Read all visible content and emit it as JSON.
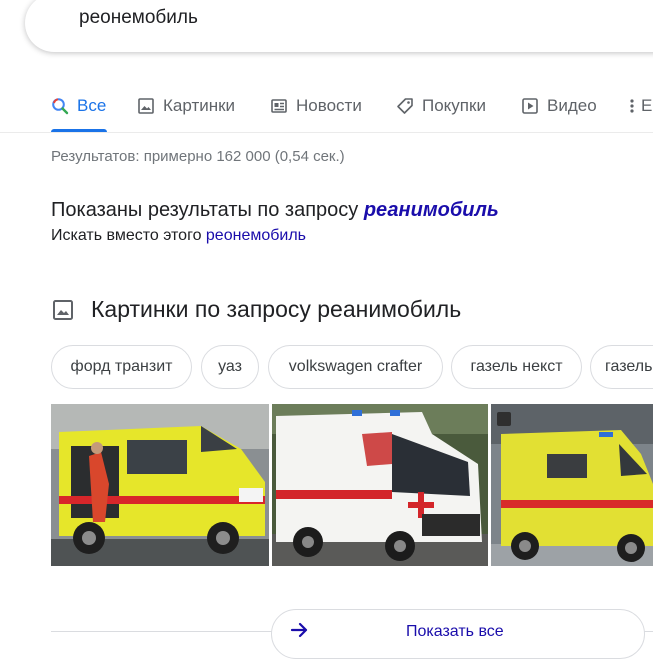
{
  "search": {
    "query": "реонемобиль"
  },
  "tabs": [
    {
      "label": "Все",
      "icon": "search-icon",
      "active": true
    },
    {
      "label": "Картинки",
      "icon": "image-icon"
    },
    {
      "label": "Новости",
      "icon": "news-icon"
    },
    {
      "label": "Покупки",
      "icon": "tag-icon"
    },
    {
      "label": "Видео",
      "icon": "play-icon"
    },
    {
      "label": "Е",
      "icon": "more-vert-icon"
    }
  ],
  "results": {
    "stats": "Результатов: примерно 162 000 (0,54 сек.)",
    "showing_prefix": "Показаны результаты по запросу ",
    "corrected_query": "реанимобиль",
    "instead_prefix": "Искать вместо этого ",
    "original_query": "реонемобиль"
  },
  "images": {
    "header": "Картинки по запросу реанимобиль",
    "chips": [
      "форд транзит",
      "уаз",
      "volkswagen crafter",
      "газель некст",
      "газель"
    ],
    "show_all": "Показать все"
  },
  "colors": {
    "accent": "#1a73e8",
    "link": "#1a0dab",
    "ambulance_yellow": "#e6e62a"
  }
}
